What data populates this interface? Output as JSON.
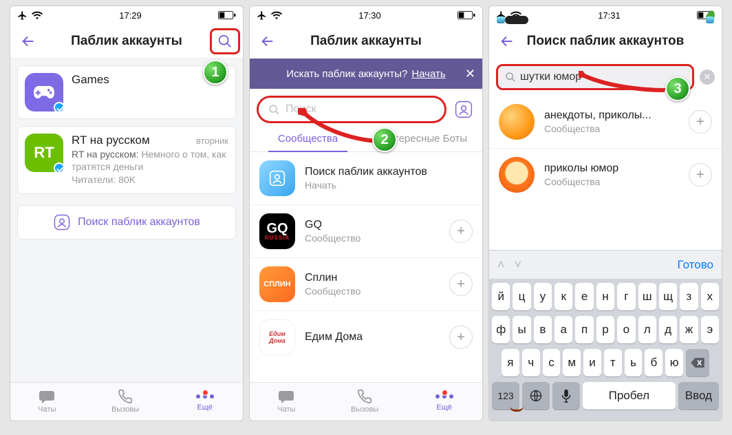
{
  "colors": {
    "accent": "#7b5fd8",
    "highlight": "#d22",
    "notif": "#ff3a30",
    "done": "#0a7aff"
  },
  "s1": {
    "time": "17:29",
    "title": "Паблик аккаунты",
    "games": {
      "name": "Games"
    },
    "rt": {
      "name": "RT на русском",
      "time": "вторник",
      "preview_prefix": "RT на русском: ",
      "preview_body": "Немного о том, как тратятся деньги",
      "readers": "Читатели: 80K"
    },
    "search_public": "Поиск паблик аккаунтов",
    "tabs": {
      "chats": "Чаты",
      "calls": "Вызовы",
      "more": "Ещё"
    },
    "callout": "1"
  },
  "s2": {
    "time": "17:30",
    "title": "Паблик аккаунты",
    "banner_text": "Искать паблик аккаунты?",
    "banner_link": "Начать",
    "search_placeholder": "Поиск",
    "tab1": "Сообщества",
    "tab2": "Интересные Боты",
    "rows": [
      {
        "title": "Поиск паблик аккаунтов",
        "sub": "Начать",
        "plus": false
      },
      {
        "title": "GQ",
        "sub": "Сообщество",
        "plus": true
      },
      {
        "title": "Сплин",
        "sub": "Сообщество",
        "plus": true
      },
      {
        "title": "Едим Дома",
        "sub": "",
        "plus": true
      }
    ],
    "tabs": {
      "chats": "Чаты",
      "calls": "Вызовы",
      "more": "Ещё"
    },
    "callout": "2"
  },
  "s3": {
    "time": "17:31",
    "title": "Поиск паблик аккаунтов",
    "search_value": "шутки юмор",
    "rows": [
      {
        "title": "анекдоты, приколы...",
        "sub": "Сообщества"
      },
      {
        "title": "приколы юмор",
        "sub": "Сообщества"
      }
    ],
    "done": "Готово",
    "kb": {
      "r1": [
        "й",
        "ц",
        "у",
        "к",
        "е",
        "н",
        "г",
        "ш",
        "щ",
        "з",
        "х"
      ],
      "r2": [
        "ф",
        "ы",
        "в",
        "а",
        "п",
        "р",
        "о",
        "л",
        "д",
        "ж",
        "э"
      ],
      "r3": [
        "я",
        "ч",
        "с",
        "м",
        "и",
        "т",
        "ь",
        "б",
        "ю"
      ],
      "n123": "123",
      "space": "Пробел",
      "enter": "Ввод"
    },
    "callout": "3"
  }
}
